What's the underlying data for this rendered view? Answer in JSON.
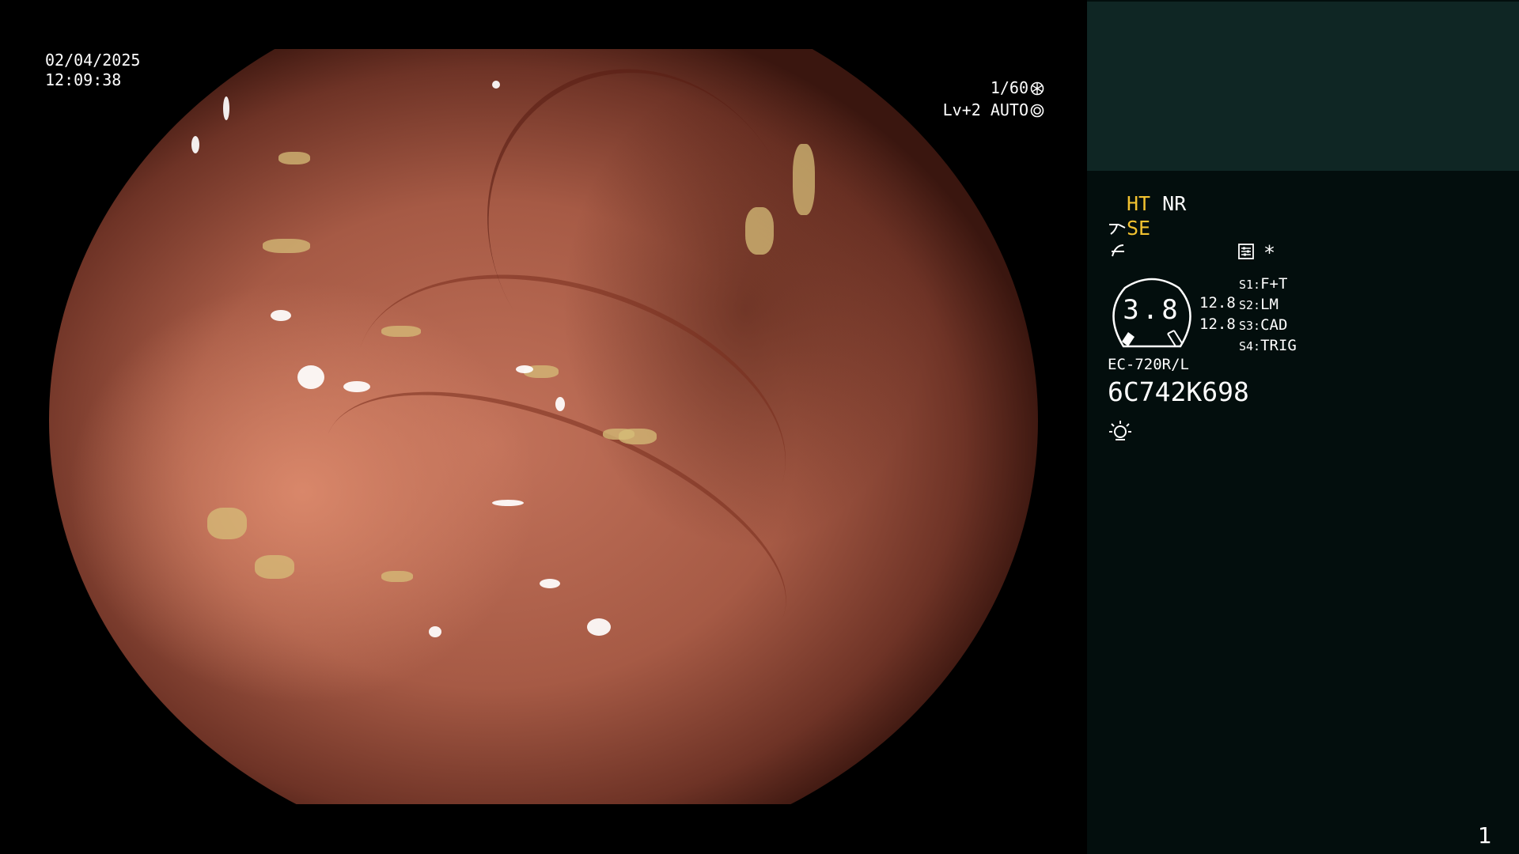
{
  "osd": {
    "date": "02/04/2025",
    "time": "12:09:38",
    "shutter": "1/60",
    "shutter_icon": "aperture-icon",
    "level": "Lv+2 AUTO",
    "level_icon": "iris-icon"
  },
  "panel": {
    "mode_ht": "HT",
    "mode_nr": "NR",
    "mode_se": "SE",
    "asterisk": "*",
    "gauge_value": "3.8",
    "ratio_top": "12.8",
    "ratio_bottom": "12.8",
    "switches": [
      {
        "key": "S1:",
        "value": "F+T"
      },
      {
        "key": "S2:",
        "value": "LM"
      },
      {
        "key": "S3:",
        "value": "CAD"
      },
      {
        "key": "S4:",
        "value": "TRIG"
      }
    ],
    "scope_model": "EC-720R/L",
    "serial": "6C742K698",
    "page_number": "1"
  },
  "colors": {
    "accent_yellow": "#f2c230",
    "panel_bg": "#030e0d",
    "panel_header_bg": "#0f2624"
  }
}
